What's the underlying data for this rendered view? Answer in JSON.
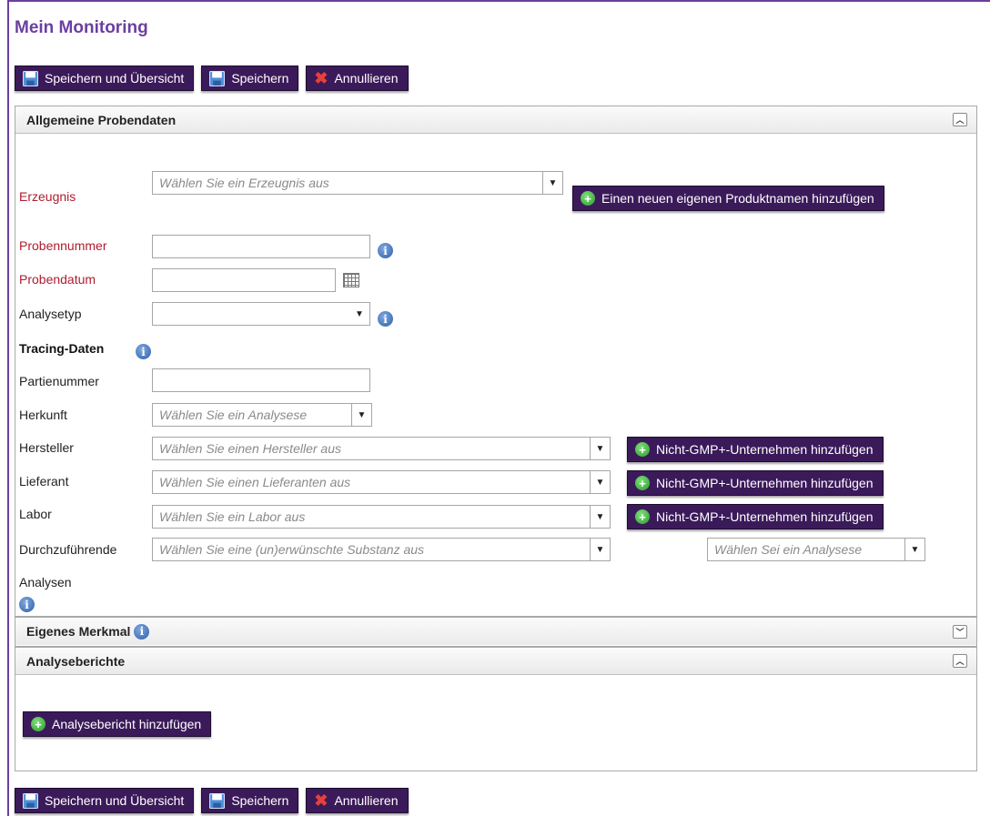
{
  "page": {
    "title": "Mein Monitoring"
  },
  "toolbar": {
    "save_overview": "Speichern und Übersicht",
    "save": "Speichern",
    "cancel": "Annullieren"
  },
  "general": {
    "header": "Allgemeine Probendaten",
    "product_label": "Erzeugnis",
    "product_placeholder": "Wählen Sie ein Erzeugnis aus",
    "add_product_button": "Einen neuen eigenen Produktnamen hinzufügen",
    "sample_number_label": "Probennummer",
    "sample_number_value": "",
    "sample_date_label": "Probendatum",
    "sample_date_value": "",
    "analysis_type_label": "Analysetyp",
    "analysis_type_value": "",
    "tracing_header": "Tracing-Daten",
    "batch_label": "Partienummer",
    "batch_value": "",
    "origin_label": "Herkunft",
    "origin_placeholder": "Wählen Sie ein Analysese",
    "manufacturer_label": "Hersteller",
    "manufacturer_placeholder": "Wählen Sie einen Hersteller aus",
    "supplier_label": "Lieferant",
    "supplier_placeholder": "Wählen Sie einen Lieferanten aus",
    "lab_label": "Labor",
    "lab_placeholder": "Wählen Sie ein Labor aus",
    "add_company_button": "Nicht-GMP+-Unternehmen hinzufügen",
    "analyses_label_1": "Durchzuführende",
    "analyses_label_2": "Analysen",
    "substance_placeholder": "Wählen Sie eine (un)erwünschte Substanz aus",
    "analysis_select_placeholder": "Wählen Sei ein Analysese"
  },
  "own_feature": {
    "header": "Eigenes Merkmal"
  },
  "reports": {
    "header": "Analyseberichte",
    "add_button": "Analysebericht hinzufügen"
  },
  "colors": {
    "accent": "#6b3fa0",
    "button_bg": "#3b1a5a",
    "required_label": "#b01c2e"
  },
  "icons": {
    "save": "floppy-disk-icon",
    "cancel": "red-x-icon",
    "add": "green-plus-icon",
    "info": "info-icon",
    "calendar": "calendar-icon",
    "collapse": "chevron-up-icon",
    "expand": "chevron-down-icon"
  }
}
